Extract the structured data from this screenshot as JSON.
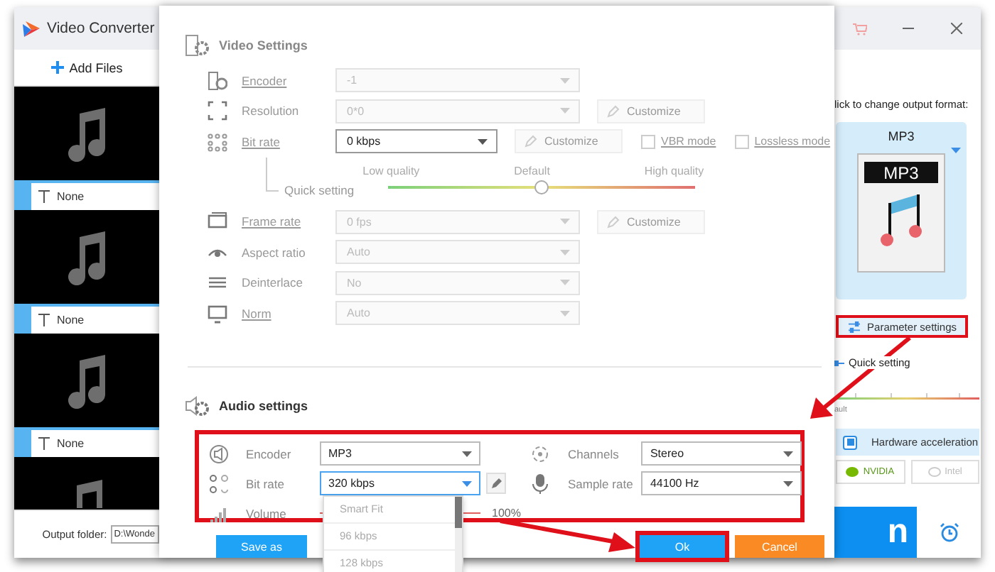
{
  "app": {
    "title": "Video Converter",
    "add_files": "Add Files",
    "files": [
      {
        "subtitle": "None"
      },
      {
        "subtitle": "None"
      },
      {
        "subtitle": "None"
      }
    ],
    "output_folder": {
      "label": "Output folder:",
      "value": "D:\\Wonde"
    }
  },
  "dialog": {
    "video": {
      "title": "Video Settings",
      "rows": [
        {
          "kind": "select",
          "label": "Encoder",
          "link": true,
          "value": "-1",
          "disabled": true
        },
        {
          "kind": "select",
          "label": "Resolution",
          "link": false,
          "value": "0*0",
          "disabled": true,
          "customize": {
            "label": "Customize",
            "disabled": true
          }
        },
        {
          "kind": "select",
          "label": "Bit rate",
          "link": true,
          "value": "0 kbps",
          "disabled": false,
          "customize": {
            "label": "Customize",
            "disabled": true
          },
          "options": [
            {
              "label": "VBR mode",
              "checked": false
            },
            {
              "label": "Lossless mode",
              "checked": false
            }
          ]
        },
        {
          "kind": "slider",
          "label": "Quick setting",
          "marks": [
            "Low quality",
            "Default",
            "High quality"
          ],
          "level": 0.5
        },
        {
          "kind": "select",
          "label": "Frame rate",
          "link": true,
          "value": "0 fps",
          "disabled": true,
          "customize": {
            "label": "Customize",
            "disabled": true
          }
        },
        {
          "kind": "select",
          "label": "Aspect ratio",
          "link": false,
          "value": "Auto",
          "disabled": true
        },
        {
          "kind": "select",
          "label": "Deinterlace",
          "link": false,
          "value": "No",
          "disabled": true
        },
        {
          "kind": "select",
          "label": "Norm",
          "link": true,
          "value": "Auto",
          "disabled": true
        }
      ]
    },
    "audio": {
      "title": "Audio settings",
      "highlighted": true,
      "rows": [
        {
          "kind": "select",
          "label": "Encoder",
          "value": "MP3",
          "open": false
        },
        {
          "kind": "select",
          "label": "Channels",
          "value": "Stereo",
          "open": false
        },
        {
          "kind": "select",
          "label": "Bit rate",
          "value": "320 kbps",
          "open": true,
          "editable": true,
          "options": [
            "Smart Fit",
            "96 kbps",
            "128 kbps"
          ]
        },
        {
          "kind": "select",
          "label": "Sample rate",
          "value": "44100 Hz",
          "open": false
        },
        {
          "kind": "slider",
          "label": "Volume",
          "level": 1,
          "reading": "100%"
        }
      ]
    },
    "buttons": [
      {
        "label": "Save as",
        "kind": "secondary",
        "highlighted": false
      },
      {
        "label": "Ok",
        "kind": "primary",
        "highlighted": true
      },
      {
        "label": "Cancel",
        "kind": "cancel",
        "highlighted": false
      }
    ]
  },
  "right_panel": {
    "format_hint": "lick to change output format:",
    "format": {
      "name": "MP3",
      "icon_text": "MP3"
    },
    "parameter_settings": {
      "label": "Parameter settings",
      "highlighted": true
    },
    "quick_setting": "Quick setting",
    "slider_caption": "ault",
    "hardware_acceleration": {
      "label": "Hardware acceleration",
      "checked": true
    },
    "gpus": [
      {
        "label": "NVIDIA",
        "disabled": false
      },
      {
        "label": "Intel",
        "disabled": true
      }
    ],
    "run_button": "n"
  }
}
